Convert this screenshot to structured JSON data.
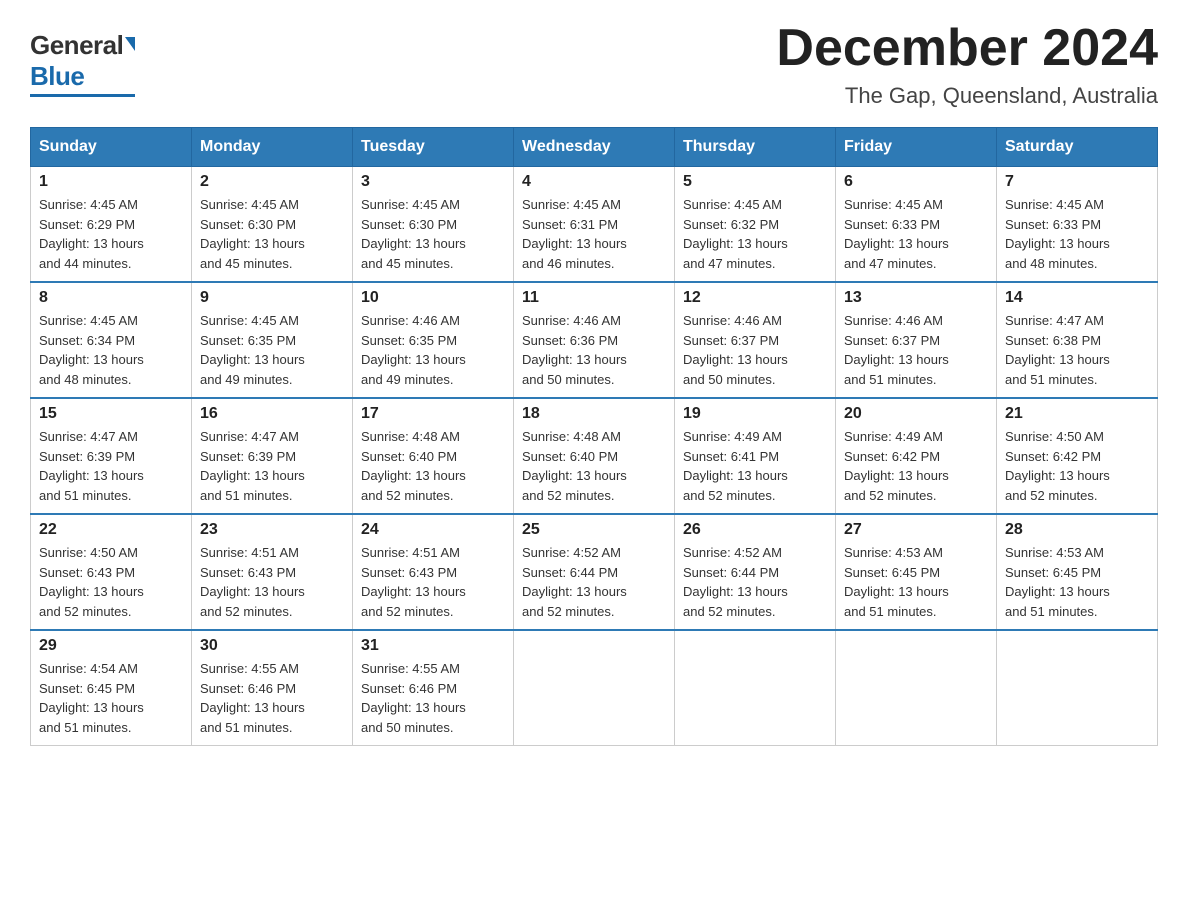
{
  "logo": {
    "general": "General",
    "blue": "Blue"
  },
  "title": "December 2024",
  "subtitle": "The Gap, Queensland, Australia",
  "days_of_week": [
    "Sunday",
    "Monday",
    "Tuesday",
    "Wednesday",
    "Thursday",
    "Friday",
    "Saturday"
  ],
  "weeks": [
    [
      {
        "day": "1",
        "sunrise": "4:45 AM",
        "sunset": "6:29 PM",
        "daylight": "13 hours and 44 minutes."
      },
      {
        "day": "2",
        "sunrise": "4:45 AM",
        "sunset": "6:30 PM",
        "daylight": "13 hours and 45 minutes."
      },
      {
        "day": "3",
        "sunrise": "4:45 AM",
        "sunset": "6:30 PM",
        "daylight": "13 hours and 45 minutes."
      },
      {
        "day": "4",
        "sunrise": "4:45 AM",
        "sunset": "6:31 PM",
        "daylight": "13 hours and 46 minutes."
      },
      {
        "day": "5",
        "sunrise": "4:45 AM",
        "sunset": "6:32 PM",
        "daylight": "13 hours and 47 minutes."
      },
      {
        "day": "6",
        "sunrise": "4:45 AM",
        "sunset": "6:33 PM",
        "daylight": "13 hours and 47 minutes."
      },
      {
        "day": "7",
        "sunrise": "4:45 AM",
        "sunset": "6:33 PM",
        "daylight": "13 hours and 48 minutes."
      }
    ],
    [
      {
        "day": "8",
        "sunrise": "4:45 AM",
        "sunset": "6:34 PM",
        "daylight": "13 hours and 48 minutes."
      },
      {
        "day": "9",
        "sunrise": "4:45 AM",
        "sunset": "6:35 PM",
        "daylight": "13 hours and 49 minutes."
      },
      {
        "day": "10",
        "sunrise": "4:46 AM",
        "sunset": "6:35 PM",
        "daylight": "13 hours and 49 minutes."
      },
      {
        "day": "11",
        "sunrise": "4:46 AM",
        "sunset": "6:36 PM",
        "daylight": "13 hours and 50 minutes."
      },
      {
        "day": "12",
        "sunrise": "4:46 AM",
        "sunset": "6:37 PM",
        "daylight": "13 hours and 50 minutes."
      },
      {
        "day": "13",
        "sunrise": "4:46 AM",
        "sunset": "6:37 PM",
        "daylight": "13 hours and 51 minutes."
      },
      {
        "day": "14",
        "sunrise": "4:47 AM",
        "sunset": "6:38 PM",
        "daylight": "13 hours and 51 minutes."
      }
    ],
    [
      {
        "day": "15",
        "sunrise": "4:47 AM",
        "sunset": "6:39 PM",
        "daylight": "13 hours and 51 minutes."
      },
      {
        "day": "16",
        "sunrise": "4:47 AM",
        "sunset": "6:39 PM",
        "daylight": "13 hours and 51 minutes."
      },
      {
        "day": "17",
        "sunrise": "4:48 AM",
        "sunset": "6:40 PM",
        "daylight": "13 hours and 52 minutes."
      },
      {
        "day": "18",
        "sunrise": "4:48 AM",
        "sunset": "6:40 PM",
        "daylight": "13 hours and 52 minutes."
      },
      {
        "day": "19",
        "sunrise": "4:49 AM",
        "sunset": "6:41 PM",
        "daylight": "13 hours and 52 minutes."
      },
      {
        "day": "20",
        "sunrise": "4:49 AM",
        "sunset": "6:42 PM",
        "daylight": "13 hours and 52 minutes."
      },
      {
        "day": "21",
        "sunrise": "4:50 AM",
        "sunset": "6:42 PM",
        "daylight": "13 hours and 52 minutes."
      }
    ],
    [
      {
        "day": "22",
        "sunrise": "4:50 AM",
        "sunset": "6:43 PM",
        "daylight": "13 hours and 52 minutes."
      },
      {
        "day": "23",
        "sunrise": "4:51 AM",
        "sunset": "6:43 PM",
        "daylight": "13 hours and 52 minutes."
      },
      {
        "day": "24",
        "sunrise": "4:51 AM",
        "sunset": "6:43 PM",
        "daylight": "13 hours and 52 minutes."
      },
      {
        "day": "25",
        "sunrise": "4:52 AM",
        "sunset": "6:44 PM",
        "daylight": "13 hours and 52 minutes."
      },
      {
        "day": "26",
        "sunrise": "4:52 AM",
        "sunset": "6:44 PM",
        "daylight": "13 hours and 52 minutes."
      },
      {
        "day": "27",
        "sunrise": "4:53 AM",
        "sunset": "6:45 PM",
        "daylight": "13 hours and 51 minutes."
      },
      {
        "day": "28",
        "sunrise": "4:53 AM",
        "sunset": "6:45 PM",
        "daylight": "13 hours and 51 minutes."
      }
    ],
    [
      {
        "day": "29",
        "sunrise": "4:54 AM",
        "sunset": "6:45 PM",
        "daylight": "13 hours and 51 minutes."
      },
      {
        "day": "30",
        "sunrise": "4:55 AM",
        "sunset": "6:46 PM",
        "daylight": "13 hours and 51 minutes."
      },
      {
        "day": "31",
        "sunrise": "4:55 AM",
        "sunset": "6:46 PM",
        "daylight": "13 hours and 50 minutes."
      },
      null,
      null,
      null,
      null
    ]
  ],
  "labels": {
    "sunrise": "Sunrise:",
    "sunset": "Sunset:",
    "daylight": "Daylight:"
  }
}
